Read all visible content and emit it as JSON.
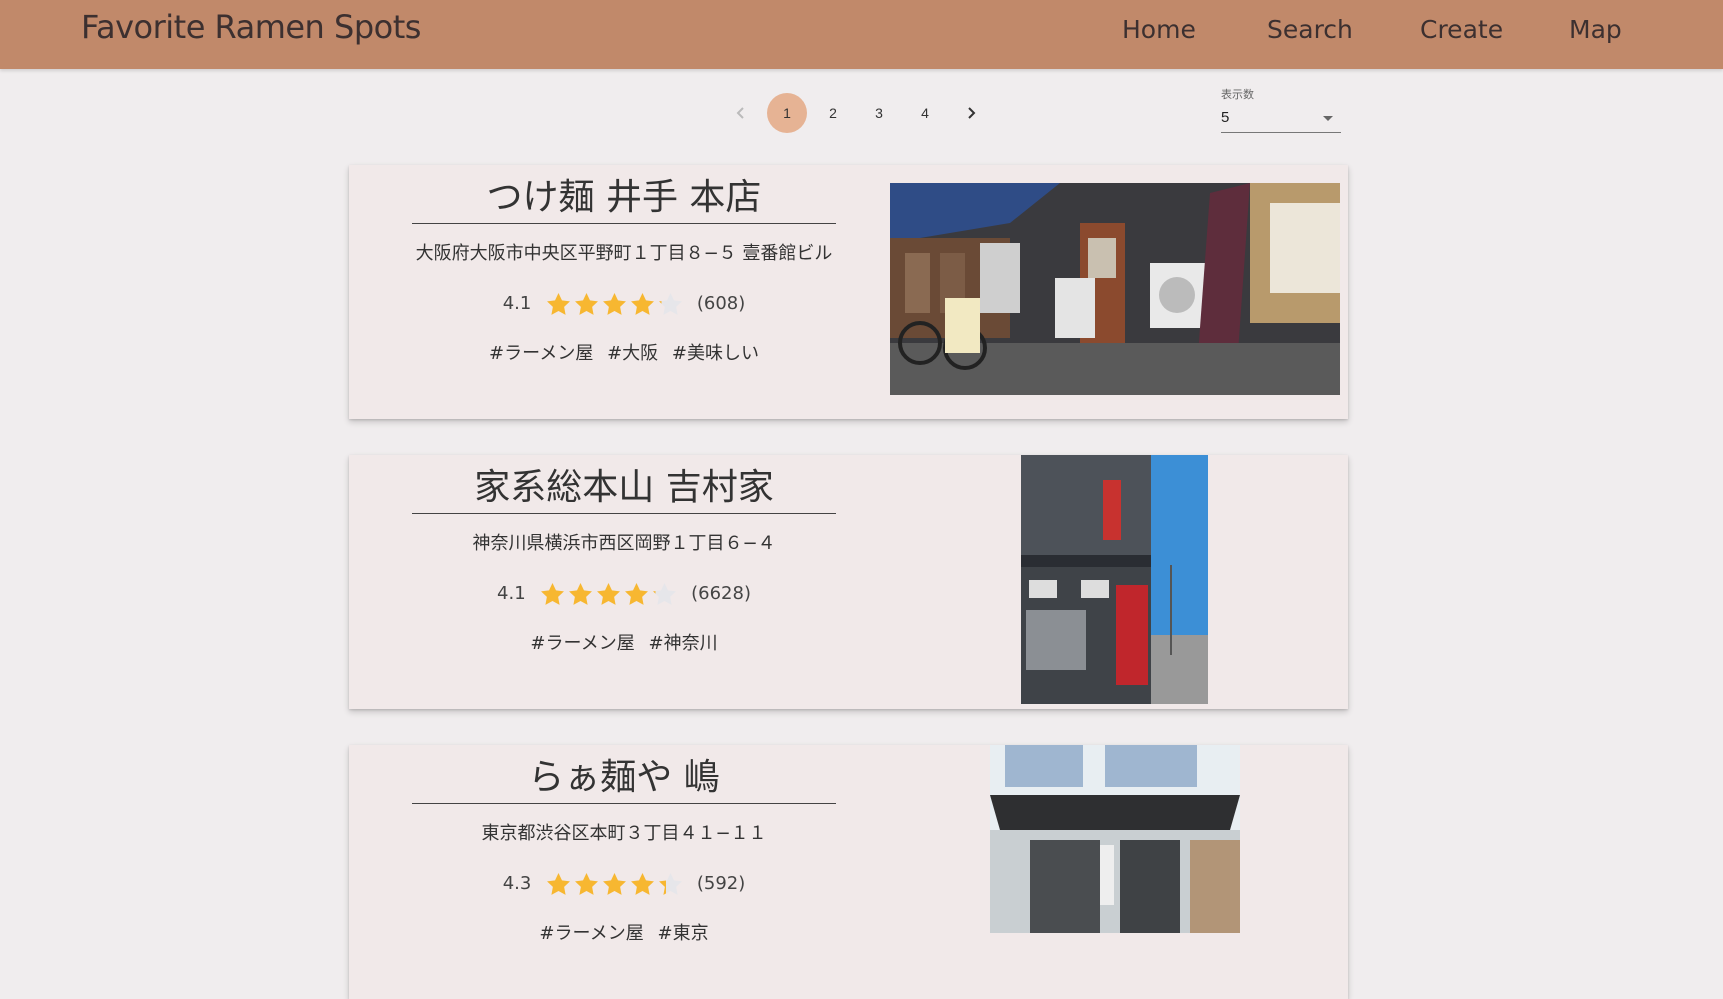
{
  "header": {
    "title": "Favorite Ramen Spots",
    "nav": [
      "Home",
      "Search",
      "Create",
      "Map"
    ]
  },
  "pagination": {
    "pages": [
      "1",
      "2",
      "3",
      "4"
    ],
    "current": "1",
    "prev_icon": "chevron-left-icon",
    "next_icon": "chevron-right-icon"
  },
  "per_page": {
    "label": "表示数",
    "value": "5"
  },
  "colors": {
    "header_bg": "#c1896a",
    "active_page": "#e6b394",
    "star": "#f7b731",
    "star_empty": "#e6e6ea"
  },
  "shops": [
    {
      "name": "つけ麺 井手 本店",
      "address": "大阪府大阪市中央区平野町１丁目８−５ 壹番館ビル",
      "rating": "4.1",
      "rating_value": 4.1,
      "reviews": "(608)",
      "tags": [
        "#ラーメン屋",
        "#大阪",
        "#美味しい"
      ]
    },
    {
      "name": "家系総本山 吉村家",
      "address": "神奈川県横浜市西区岡野１丁目６−４",
      "rating": "4.1",
      "rating_value": 4.1,
      "reviews": "(6628)",
      "tags": [
        "#ラーメン屋",
        "#神奈川"
      ]
    },
    {
      "name": "らぁ麺や 嶋",
      "address": "東京都渋谷区本町３丁目４１−１１",
      "rating": "4.3",
      "rating_value": 4.3,
      "reviews": "(592)",
      "tags": [
        "#ラーメン屋",
        "#東京"
      ]
    }
  ]
}
